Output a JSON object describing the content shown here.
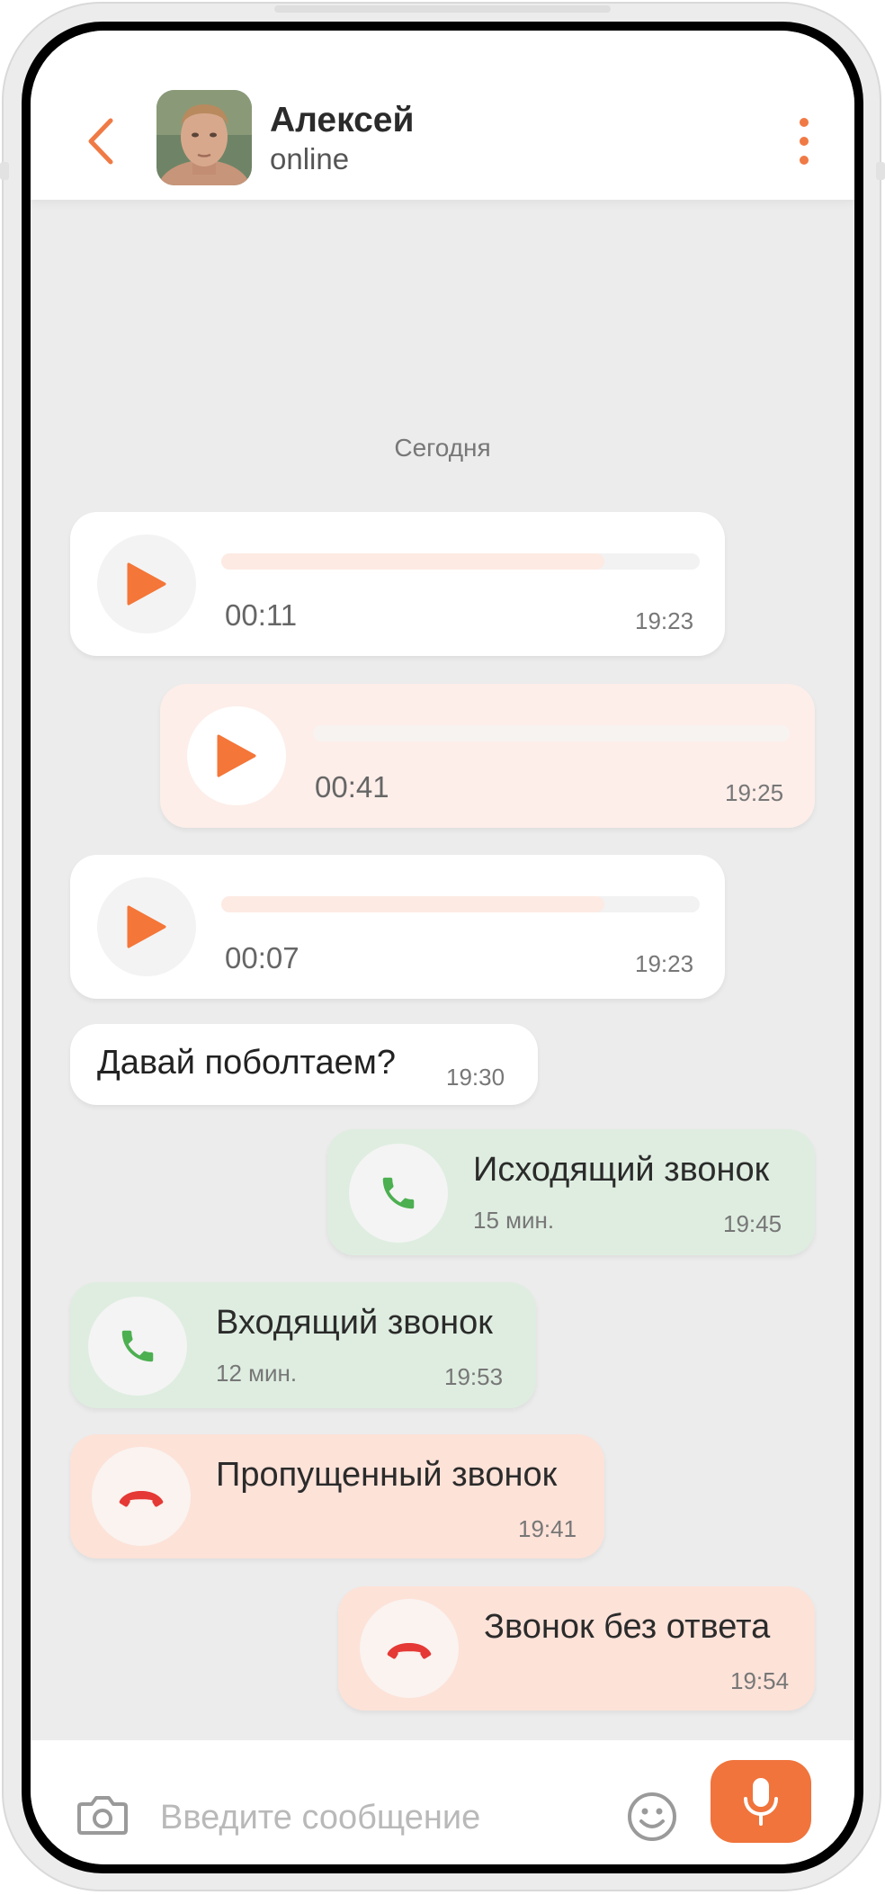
{
  "header": {
    "contact_name": "Алексей",
    "contact_status": "online"
  },
  "chat": {
    "date_separator": "Сегодня",
    "voice_messages": [
      {
        "duration": "00:11",
        "time": "19:23",
        "progress": 0.8,
        "direction": "incoming"
      },
      {
        "duration": "00:41",
        "time": "19:25",
        "progress": 0.0,
        "direction": "outgoing"
      },
      {
        "duration": "00:07",
        "time": "19:23",
        "progress": 0.8,
        "direction": "incoming"
      }
    ],
    "text_message": {
      "text": "Давай поболтаем?",
      "time": "19:30"
    },
    "calls": [
      {
        "title": "Исходящий звонок",
        "duration": "15 мин.",
        "time": "19:45",
        "status": "outgoing"
      },
      {
        "title": "Входящий звонок",
        "duration": "12 мин.",
        "time": "19:53",
        "status": "incoming"
      },
      {
        "title": "Пропущенный звонок",
        "time": "19:41",
        "status": "missed"
      },
      {
        "title": "Звонок без ответа",
        "time": "19:54",
        "status": "unanswered"
      }
    ]
  },
  "input": {
    "placeholder": "Введите сообщение"
  },
  "colors": {
    "accent": "#f0743c",
    "call_green": "#4caf50",
    "call_red": "#e53935",
    "play_orange": "#f47638"
  },
  "icons": {
    "back": "chevron-left-icon",
    "menu": "more-vertical-icon",
    "play": "play-icon",
    "phone": "phone-icon",
    "hangup": "phone-hangup-icon",
    "camera": "camera-icon",
    "emoji": "smile-icon",
    "mic": "microphone-icon"
  }
}
